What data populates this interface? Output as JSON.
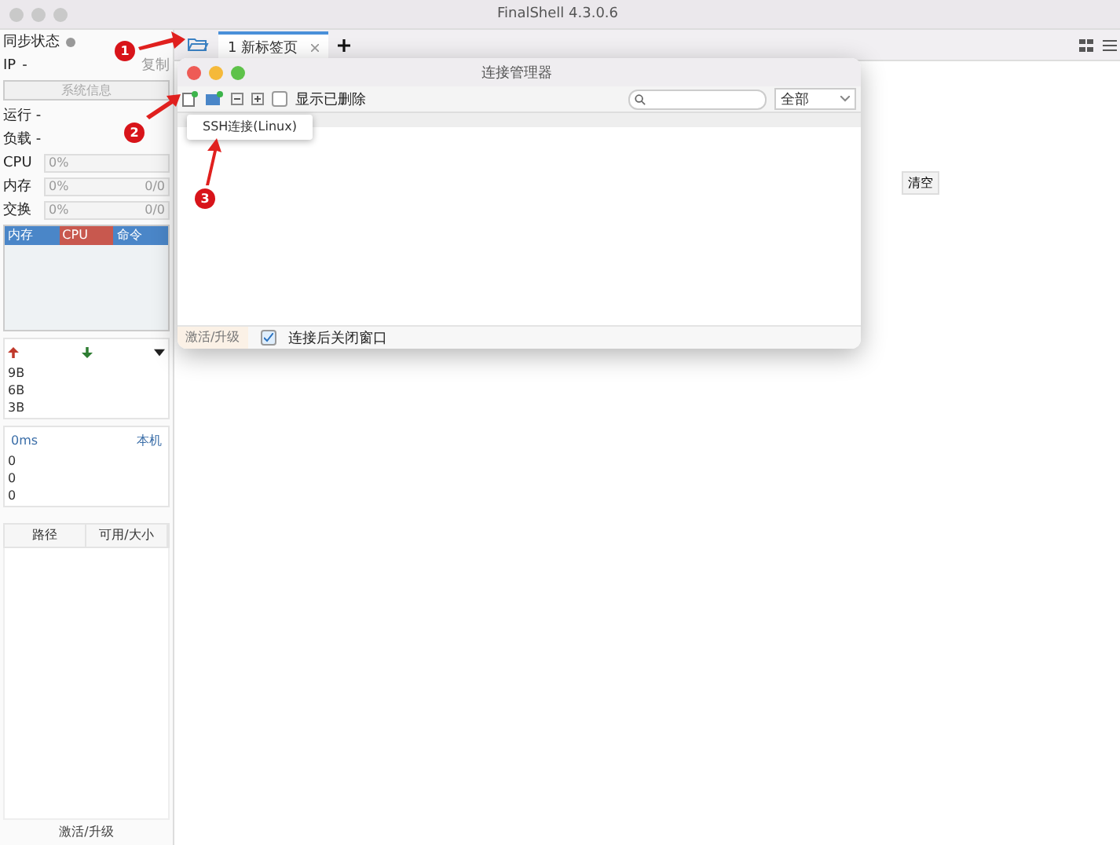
{
  "window": {
    "title": "FinalShell 4.3.0.6"
  },
  "sidebar": {
    "sync_label": "同步状态",
    "ip_label": "IP",
    "ip_value": "-",
    "copy": "复制",
    "sysinfo_button": "系统信息",
    "stats": [
      "运行 -",
      "负载 -"
    ],
    "meters": [
      {
        "label": "CPU",
        "percent": "0%"
      },
      {
        "label": "内存",
        "percent": "0%",
        "amount": "0/0"
      },
      {
        "label": "交换",
        "percent": "0%",
        "amount": "0/0"
      }
    ],
    "process_columns": [
      {
        "label": "内存",
        "color": "#4a86c8"
      },
      {
        "label": "CPU",
        "color": "#c8584e"
      },
      {
        "label": "命令",
        "color": "#4a86c8"
      }
    ],
    "net_values": [
      "9B",
      "6B",
      "3B"
    ],
    "ping": {
      "latency": "0ms",
      "host": "本机",
      "values": [
        "0",
        "0",
        "0"
      ]
    },
    "disk_columns": [
      "路径",
      "可用/大小"
    ],
    "activate": "激活/升级"
  },
  "tabs": [
    {
      "label": "1  新标签页",
      "selected": true
    }
  ],
  "clear_button": "清空",
  "dialog": {
    "title": "连接管理器",
    "show_deleted": {
      "label": "显示已删除",
      "checked": false
    },
    "filter": "全部",
    "menu": [
      "SSH连接(Linux)"
    ],
    "activate": "激活/升级",
    "close_after": {
      "label": "连接后关闭窗口",
      "checked": true
    }
  },
  "annotations": [
    "1",
    "2",
    "3"
  ]
}
